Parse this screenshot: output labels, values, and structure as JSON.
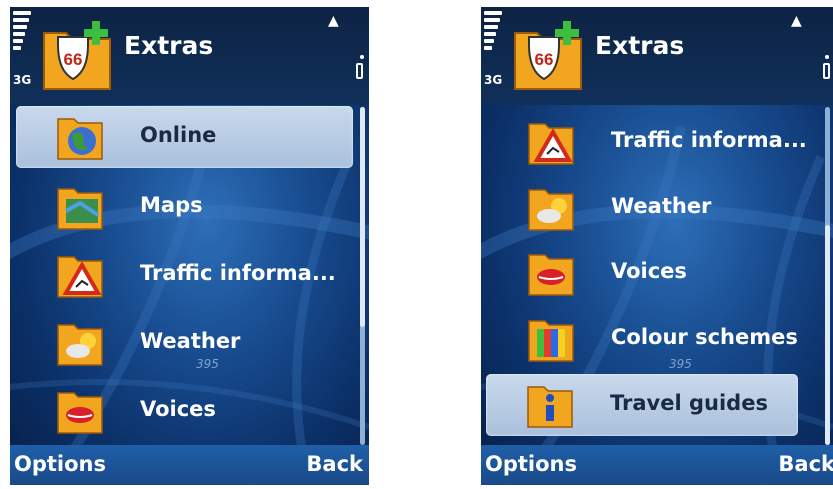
{
  "screens": [
    {
      "title": "Extras",
      "network": "3G",
      "items": [
        {
          "label": "Online",
          "icon": "globe-folder-icon",
          "selected": true
        },
        {
          "label": "Maps",
          "icon": "map-folder-icon",
          "selected": false
        },
        {
          "label": "Traffic informa...",
          "icon": "traffic-warning-folder-icon",
          "selected": false
        },
        {
          "label": "Weather",
          "icon": "weather-folder-icon",
          "selected": false
        },
        {
          "label": "Voices",
          "icon": "lips-folder-icon",
          "selected": false
        }
      ],
      "map_label": "395",
      "softkeys": {
        "left": "Options",
        "right": "Back"
      },
      "scroll_position": 0.0
    },
    {
      "title": "Extras",
      "network": "3G",
      "items": [
        {
          "label": "Traffic informa...",
          "icon": "traffic-warning-folder-icon",
          "selected": false
        },
        {
          "label": "Weather",
          "icon": "weather-folder-icon",
          "selected": false
        },
        {
          "label": "Voices",
          "icon": "lips-folder-icon",
          "selected": false
        },
        {
          "label": "Colour schemes",
          "icon": "colour-schemes-folder-icon",
          "selected": false
        },
        {
          "label": "Travel guides",
          "icon": "info-folder-icon",
          "selected": true
        }
      ],
      "map_label": "395",
      "softkeys": {
        "left": "Options",
        "right": "Back"
      },
      "scroll_position": 1.0
    }
  ],
  "colors": {
    "background": "#174a8d",
    "softkey_bar": "#1f5fa7",
    "selection": "#b8cce4"
  }
}
